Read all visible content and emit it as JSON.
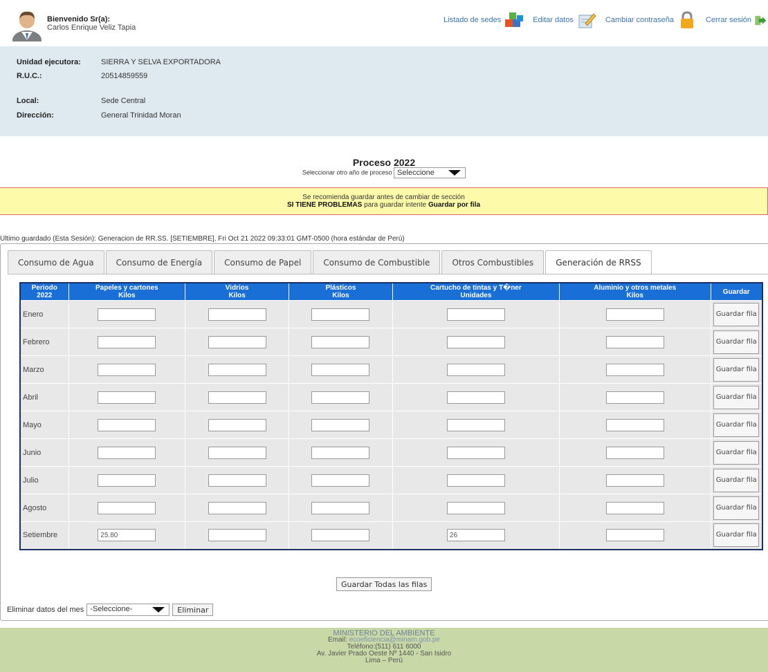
{
  "header": {
    "welcome": "Bienvenido Sr(a):",
    "user_name": "Carlos Enrique Veliz Tapia",
    "links": [
      {
        "label": "Listado de sedes",
        "icon": "blocks-icon"
      },
      {
        "label": "Editar datos",
        "icon": "edit-notepad-icon"
      },
      {
        "label": "Cambiar contraseña",
        "icon": "padlock-icon"
      },
      {
        "label": "Cerrar sesión",
        "icon": "logout-icon"
      }
    ]
  },
  "info": {
    "unidad_label": "Unidad ejecutora:",
    "unidad_value": "SIERRA Y SELVA EXPORTADORA",
    "ruc_label": "R.U.C.:",
    "ruc_value": "20514859559",
    "local_label": "Local:",
    "local_value": "Sede Central",
    "direccion_label": "Dirección:",
    "direccion_value": "General Trinidad Moran"
  },
  "process": {
    "title": "Proceso 2022",
    "select_label": "Seleccionar otro año de proceso",
    "select_value": "Seleccione"
  },
  "warning": {
    "line1": "Se recomienda guardar antes de cambiar de sección",
    "line2_bold": "SI TIENE PROBLEMAS",
    "line2_mid": " para guardar intente ",
    "line2_bold2": "Guardar por fila"
  },
  "last_saved": "Ultimo guardado (Esta Sesión): Generacion de RR.SS. [SETIEMBRE], Fri Oct 21 2022 09:33:01 GMT-0500 (hora estándar de Perú)",
  "tabs": [
    {
      "label": "Consumo de Agua",
      "active": false
    },
    {
      "label": "Consumo de Energía",
      "active": false
    },
    {
      "label": "Consumo de Papel",
      "active": false
    },
    {
      "label": "Consumo de Combustible",
      "active": false
    },
    {
      "label": "Otros Combustibles",
      "active": false
    },
    {
      "label": "Generación de RRSS",
      "active": true
    }
  ],
  "table": {
    "period_header": "Periodo",
    "period_year": "2022",
    "columns": [
      {
        "name": "Papeles y cartones",
        "unit": "Kilos"
      },
      {
        "name": "Vidrios",
        "unit": "Kilos"
      },
      {
        "name": "Plásticos",
        "unit": "Kilos"
      },
      {
        "name": "Cartucho de tintas y T�ner",
        "unit": "Unidades"
      },
      {
        "name": "Aluminio y otros metales",
        "unit": "Kilos"
      }
    ],
    "save_header": "Guardar",
    "row_button": "Guardar fila",
    "rows": [
      {
        "month": "Enero",
        "values": [
          "",
          "",
          "",
          "",
          ""
        ]
      },
      {
        "month": "Febrero",
        "values": [
          "",
          "",
          "",
          "",
          ""
        ]
      },
      {
        "month": "Marzo",
        "values": [
          "",
          "",
          "",
          "",
          ""
        ]
      },
      {
        "month": "Abril",
        "values": [
          "",
          "",
          "",
          "",
          ""
        ]
      },
      {
        "month": "Mayo",
        "values": [
          "",
          "",
          "",
          "",
          ""
        ]
      },
      {
        "month": "Junio",
        "values": [
          "",
          "",
          "",
          "",
          ""
        ]
      },
      {
        "month": "Julio",
        "values": [
          "",
          "",
          "",
          "",
          ""
        ]
      },
      {
        "month": "Agosto",
        "values": [
          "",
          "",
          "",
          "",
          ""
        ]
      },
      {
        "month": "Setiembre",
        "values": [
          "25.80",
          "",
          "",
          "26",
          ""
        ]
      }
    ]
  },
  "save_all": "Guardar Todas las filas",
  "delete": {
    "label": "Eliminar datos del mes",
    "select_value": "-Seleccione-",
    "button": "Eliminar"
  },
  "footer": {
    "ministry": "MINISTERIO DEL AMBIENTE",
    "email_label": "Email: ",
    "email": "ecoeficiencia@minam.gob.pe",
    "phone": "Teléfono:(511) 611 6000",
    "address": "Av. Javier Prado Oeste Nº 1440 - San Isidro",
    "city": "Lima – Perú"
  },
  "colors": {
    "header_blue": "#1a6fd6",
    "info_bg": "#dfeaf0",
    "warning_bg": "#fdfaa9",
    "footer_bg": "#c8d8a6"
  }
}
